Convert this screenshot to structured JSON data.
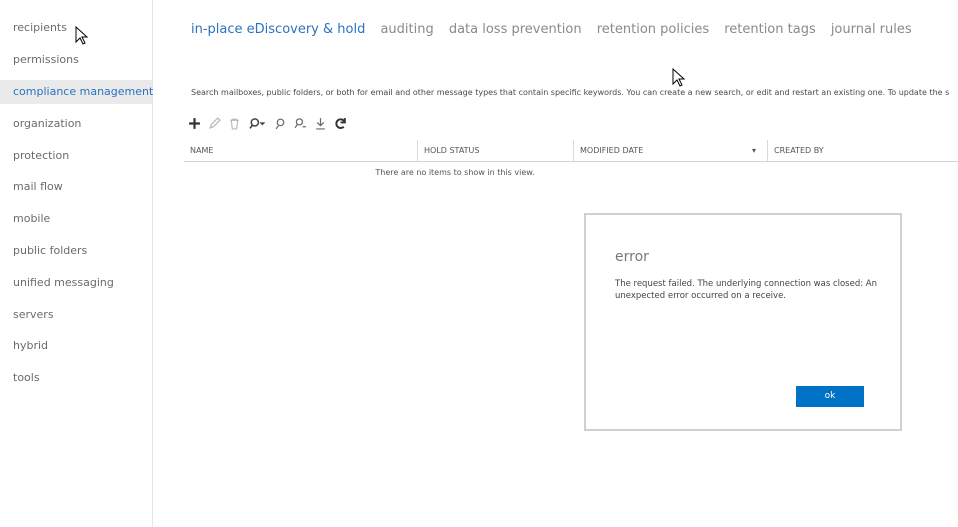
{
  "sidebar": {
    "items": [
      {
        "label": "recipients"
      },
      {
        "label": "permissions"
      },
      {
        "label": "compliance management",
        "active": true
      },
      {
        "label": "organization"
      },
      {
        "label": "protection"
      },
      {
        "label": "mail flow"
      },
      {
        "label": "mobile"
      },
      {
        "label": "public folders"
      },
      {
        "label": "unified messaging"
      },
      {
        "label": "servers"
      },
      {
        "label": "hybrid"
      },
      {
        "label": "tools"
      }
    ]
  },
  "tabs": [
    {
      "label": "in-place eDiscovery & hold",
      "active": true
    },
    {
      "label": "auditing"
    },
    {
      "label": "data loss prevention"
    },
    {
      "label": "retention policies"
    },
    {
      "label": "retention tags"
    },
    {
      "label": "journal rules"
    }
  ],
  "description": "Search mailboxes, public folders, or both for email and other message types that contain specific keywords. You can create a new search, or edit and restart an existing one. To update the s",
  "toolbar": {
    "icons": [
      "add-icon",
      "edit-icon",
      "delete-icon",
      "search-icon",
      "preview-icon",
      "copy-search-icon",
      "export-icon",
      "refresh-icon"
    ]
  },
  "grid": {
    "columns": [
      "NAME",
      "HOLD STATUS",
      "MODIFIED DATE",
      "CREATED BY"
    ],
    "sort_indicator": "▾",
    "empty_message": "There are no items to show in this view."
  },
  "dialog": {
    "title": "error",
    "message": "The request failed. The underlying connection was closed: An unexpected error occurred on a receive.",
    "ok_label": "ok"
  },
  "colors": {
    "accent": "#2a72c0",
    "button": "#0072c6",
    "nav_active_bg": "#eaeaea"
  }
}
